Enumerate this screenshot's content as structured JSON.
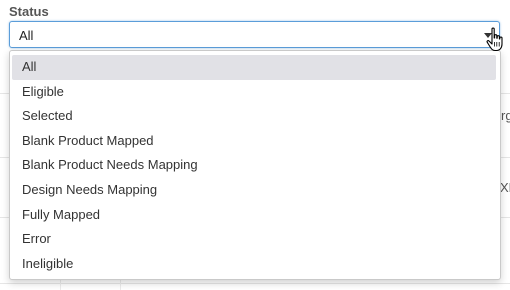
{
  "filter": {
    "label": "Status",
    "selected_value": "All",
    "options": [
      {
        "label": "All",
        "selected": true
      },
      {
        "label": "Eligible",
        "selected": false
      },
      {
        "label": "Selected",
        "selected": false
      },
      {
        "label": "Blank Product Mapped",
        "selected": false
      },
      {
        "label": "Blank Product Needs Mapping",
        "selected": false
      },
      {
        "label": "Design Needs Mapping",
        "selected": false
      },
      {
        "label": "Fully Mapped",
        "selected": false
      },
      {
        "label": "Error",
        "selected": false
      },
      {
        "label": "Ineligible",
        "selected": false
      }
    ]
  },
  "background": {
    "cell_fragments": [
      "rg",
      "XL"
    ]
  },
  "colors": {
    "focus_border": "#5b9dd9",
    "selected_option_bg": "#e1e1e6"
  },
  "icons": {
    "caret": "caret-down-icon",
    "cursor": "hand-pointer-icon"
  }
}
